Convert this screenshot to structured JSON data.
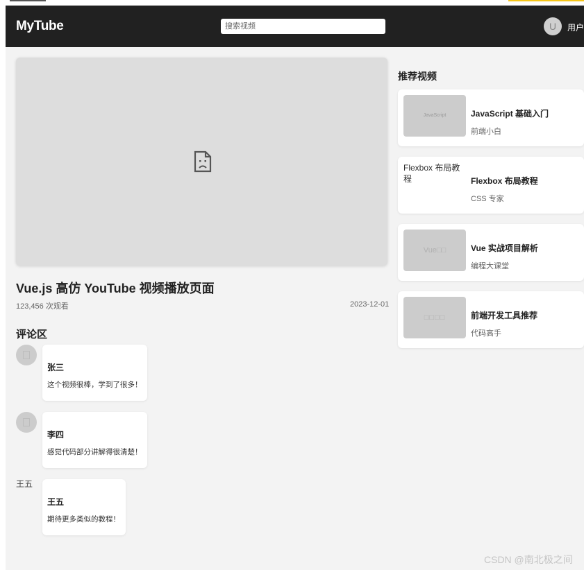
{
  "header": {
    "logo": "MyTube",
    "search_placeholder": "搜索视频",
    "avatar_letter": "U",
    "username": "用户"
  },
  "video": {
    "title": "Vue.js 高仿 YouTube 视频播放页面",
    "views": "123,456 次观看",
    "date": "2023-12-01"
  },
  "comments": {
    "heading": "评论区",
    "items": [
      {
        "name": "张三",
        "text": "这个视频很棒，学到了很多！"
      },
      {
        "name": "李四",
        "text": "感觉代码部分讲解得很清楚！"
      },
      {
        "name": "王五",
        "text": "期待更多类似的教程！",
        "avatar_alt": "王五"
      }
    ]
  },
  "recommended": {
    "heading": "推荐视频",
    "items": [
      {
        "thumb_text": "JavaScript",
        "title": "JavaScript 基础入门",
        "author": "前端小白"
      },
      {
        "thumb_alt": "Flexbox 布局教程",
        "title": "Flexbox 布局教程",
        "author": "CSS 专家"
      },
      {
        "thumb_text": "Vue□□",
        "title": "Vue 实战项目解析",
        "author": "编程大课堂"
      },
      {
        "thumb_text": "□□□□",
        "title": "前端开发工具推荐",
        "author": "代码高手"
      }
    ]
  },
  "watermark": "CSDN @南北极之间"
}
